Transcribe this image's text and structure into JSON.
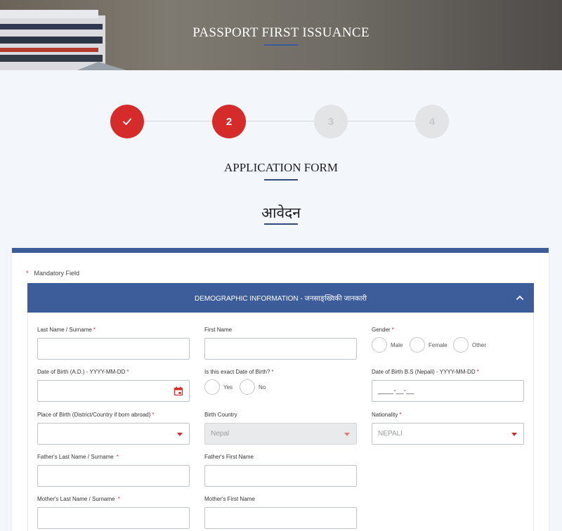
{
  "header": {
    "title": "PASSPORT FIRST ISSUANCE"
  },
  "stepper": {
    "steps": [
      {
        "label": "",
        "state": "done"
      },
      {
        "label": "2",
        "state": "active"
      },
      {
        "label": "3",
        "state": "pending"
      },
      {
        "label": "4",
        "state": "pending"
      }
    ]
  },
  "page": {
    "title_en": "APPLICATION FORM",
    "title_np": "आवेदन"
  },
  "form": {
    "mandatory_marker": "*",
    "mandatory_text": "Mandatory Field",
    "section_title": "DEMOGRAPHIC INFORMATION - जनसाङ्ख्यिकी जानकारी",
    "fields": {
      "last_name": {
        "label": "Last Name / Surname",
        "required": "*",
        "value": ""
      },
      "first_name": {
        "label": "First Name",
        "value": ""
      },
      "gender": {
        "label": "Gender",
        "required": "*",
        "options": [
          "Male",
          "Female",
          "Other"
        ]
      },
      "dob_ad": {
        "label": "Date of Birth (A.D.) - YYYY-MM-DD",
        "required": "*",
        "value": ""
      },
      "exact_dob": {
        "label": "Is this exact Date of Birth?",
        "required": "*",
        "options": [
          "Yes",
          "No"
        ]
      },
      "dob_bs": {
        "label": "Date of Birth B.S (Nepali) - YYYY-MM-DD",
        "required": "*",
        "value": "____-__-__"
      },
      "place_of_birth": {
        "label": "Place of Birth (District/Country if born abroad)",
        "required": "*",
        "value": ""
      },
      "birth_country": {
        "label": "Birth Country",
        "value": "Nepal"
      },
      "nationality": {
        "label": "Nationality",
        "required": "*",
        "value": "NEPALI"
      },
      "father_last": {
        "label": "Father's Last Name / Surname",
        "required": "*",
        "value": ""
      },
      "father_first": {
        "label": "Father's First Name",
        "value": ""
      },
      "mother_last": {
        "label": "Mother's Last Name / Surname",
        "required": "*",
        "value": ""
      },
      "mother_first": {
        "label": "Mother's First Name",
        "value": ""
      }
    }
  },
  "colors": {
    "accent_red": "#d62b2b",
    "brand_blue": "#3d5c9a"
  }
}
